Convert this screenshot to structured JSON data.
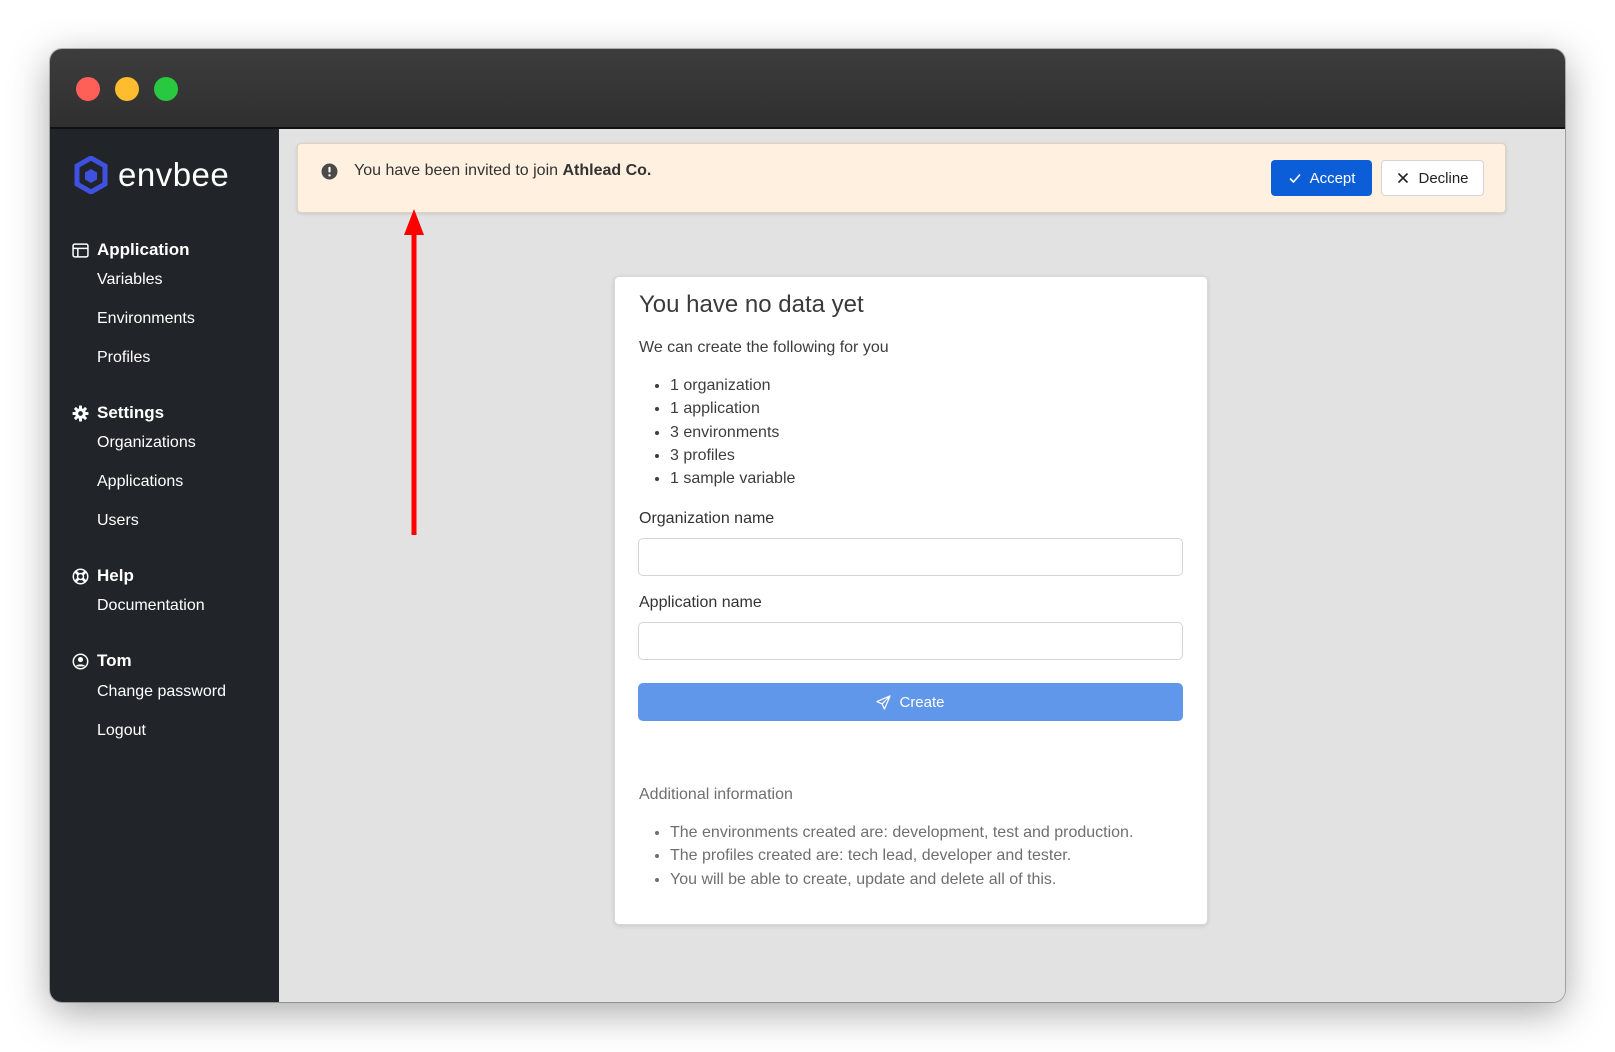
{
  "window": {
    "controls": [
      "close",
      "minimize",
      "zoom"
    ]
  },
  "sidebar": {
    "logo_text": "envbee",
    "sections": [
      {
        "title": "Application",
        "icon": "table-icon",
        "items": [
          "Variables",
          "Environments",
          "Profiles"
        ]
      },
      {
        "title": "Settings",
        "icon": "gear-icon",
        "items": [
          "Organizations",
          "Applications",
          "Users"
        ]
      },
      {
        "title": "Help",
        "icon": "lifebuoy-icon",
        "items": [
          "Documentation"
        ]
      },
      {
        "title": "Tom",
        "icon": "user-circle-icon",
        "items": [
          "Change password",
          "Logout"
        ]
      }
    ]
  },
  "banner": {
    "icon": "exclamation-circle-icon",
    "text_prefix": "You have been invited to join ",
    "org_name": "Athlead Co.",
    "accept_label": "Accept",
    "decline_label": "Decline",
    "accept_color": "#0b5ed7"
  },
  "card": {
    "title": "You have no data yet",
    "subtitle": "We can create the following for you",
    "items": [
      "1 organization",
      "1 application",
      "3 environments",
      "3 profiles",
      "1 sample variable"
    ],
    "org_label": "Organization name",
    "org_value": "",
    "app_label": "Application name",
    "app_value": "",
    "create_label": "Create",
    "create_color": "#6097eb",
    "additional_title": "Additional information",
    "additional_items": [
      "The environments created are: development, test and production.",
      "The profiles created are: tech lead, developer and tester.",
      "You will be able to create, update and delete all of this."
    ]
  },
  "annotation": {
    "arrow_color": "#ff0000"
  }
}
